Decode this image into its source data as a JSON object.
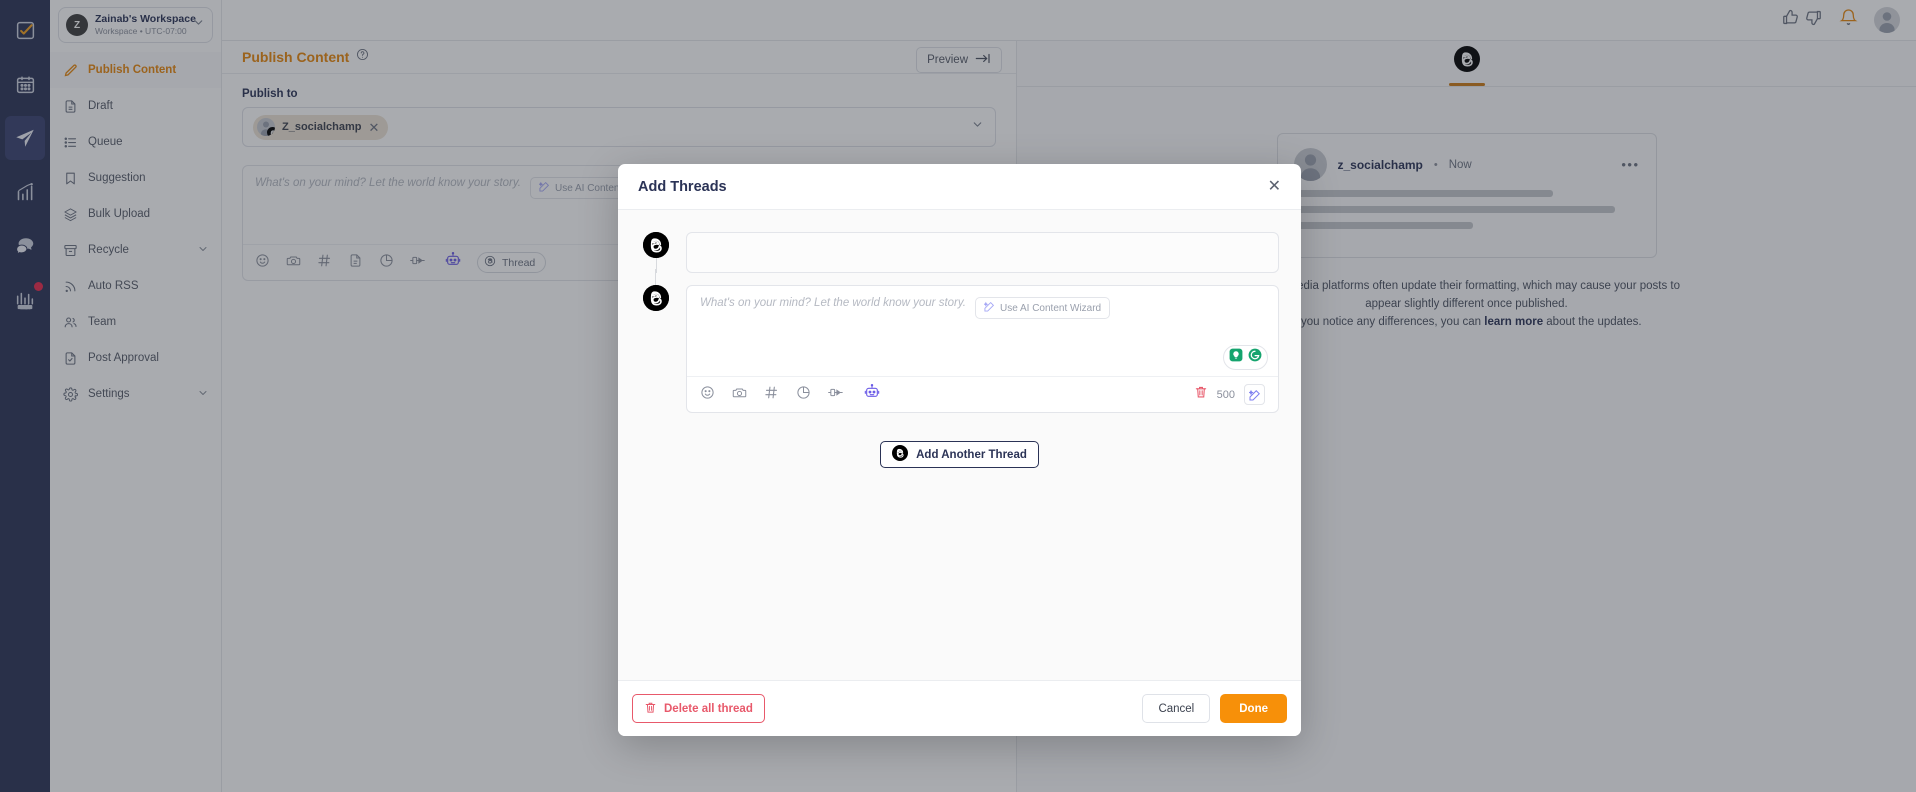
{
  "workspace": {
    "initial": "Z",
    "name": "Zainab's Workspace",
    "subtitle": "Workspace • UTC-07:00"
  },
  "rail": {
    "items": [
      {
        "icon": "checkbox-pencil-icon",
        "active": false
      },
      {
        "icon": "calendar-icon",
        "active": false
      },
      {
        "icon": "paper-plane-icon",
        "active": true
      },
      {
        "icon": "analytics-chart-icon",
        "active": false
      },
      {
        "icon": "chat-bubbles-icon",
        "active": false
      },
      {
        "icon": "beta-chart-icon",
        "active": false
      }
    ]
  },
  "sidebar": {
    "items": [
      {
        "label": "Publish Content",
        "icon": "pencil-icon",
        "active": true,
        "chevron": false
      },
      {
        "label": "Draft",
        "icon": "document-icon",
        "active": false,
        "chevron": false
      },
      {
        "label": "Queue",
        "icon": "list-icon",
        "active": false,
        "chevron": false
      },
      {
        "label": "Suggestion",
        "icon": "bookmark-icon",
        "active": false,
        "chevron": false
      },
      {
        "label": "Bulk Upload",
        "icon": "layers-icon",
        "active": false,
        "chevron": false
      },
      {
        "label": "Recycle",
        "icon": "archive-icon",
        "active": false,
        "chevron": true
      },
      {
        "label": "Auto RSS",
        "icon": "rss-icon",
        "active": false,
        "chevron": false
      },
      {
        "label": "Team",
        "icon": "people-icon",
        "active": false,
        "chevron": false
      },
      {
        "label": "Post Approval",
        "icon": "document-check-icon",
        "active": false,
        "chevron": false
      },
      {
        "label": "Settings",
        "icon": "gear-icon",
        "active": false,
        "chevron": true
      }
    ]
  },
  "page": {
    "title": "Publish Content",
    "help_icon": "question-circle-icon",
    "preview_label": "Preview",
    "preview_icon": "arrow-to-right-icon"
  },
  "composer": {
    "publish_to_label": "Publish to",
    "chip": {
      "name": "Z_socialchamp",
      "remove_icon": "close-icon",
      "badge_icon": "threads-icon"
    },
    "placeholder": "What's on your mind? Let the world know your story.",
    "wizard_label": "Use AI Content Wizard",
    "wizard_icon": "magic-wand-icon",
    "tools": [
      {
        "icon": "emoji-icon"
      },
      {
        "icon": "camera-icon"
      },
      {
        "icon": "hashtag-icon"
      },
      {
        "icon": "document-icon"
      },
      {
        "icon": "pie-chart-icon"
      },
      {
        "icon": "plug-icon"
      },
      {
        "icon": "robot-icon"
      }
    ],
    "thread_pill_label": "Thread",
    "thread_pill_icon": "threads-icon"
  },
  "preview": {
    "tab_icon": "threads-icon",
    "username": "z_socialchamp",
    "separator": "•",
    "timestamp": "Now",
    "more_icon": "ellipsis-icon",
    "skeleton_widths": [
      "75%",
      "93%",
      "52%"
    ],
    "note_line1": "Social media platforms often update their formatting, which may cause your posts",
    "note_line2": "to appear slightly different once published.",
    "note_line3_prefix": "If you notice any differences, you can ",
    "note_link": "learn more",
    "note_line3_suffix": " about the updates."
  },
  "header_icons": {
    "thumbs_up": "thumbs-up-icon",
    "thumbs_down": "thumbs-down-icon",
    "bell": "bell-icon",
    "avatar": "user-avatar-icon"
  },
  "modal": {
    "title": "Add Threads",
    "close_icon": "close-icon",
    "threads": [
      {
        "avatar_icon": "threads-icon",
        "placeholder": "",
        "type": "collapsed"
      },
      {
        "avatar_icon": "threads-icon",
        "placeholder": "What's on your mind? Let the world know your story.",
        "type": "editor",
        "wizard_label": "Use AI Content Wizard",
        "wizard_icon": "magic-wand-icon",
        "char_count": "500",
        "delete_icon": "trash-icon",
        "wand_icon": "magic-wand-icon",
        "grammarly_icons": [
          "lightbulb-icon",
          "grammarly-logo-icon"
        ],
        "tools": [
          {
            "icon": "emoji-icon"
          },
          {
            "icon": "camera-icon"
          },
          {
            "icon": "hashtag-icon"
          },
          {
            "icon": "pie-chart-icon"
          },
          {
            "icon": "plug-icon"
          },
          {
            "icon": "robot-icon"
          }
        ]
      }
    ],
    "add_another_label": "Add Another Thread",
    "add_another_icon": "threads-icon",
    "delete_all_label": "Delete all thread",
    "delete_all_icon": "trash-icon",
    "cancel_label": "Cancel",
    "done_label": "Done"
  },
  "colors": {
    "accent_orange": "#e8870c",
    "done_orange": "#f79009",
    "navy": "#2b3356",
    "rail_bg": "#2b3356",
    "danger_red": "#e8596b",
    "robot_purple": "#6c5ce7",
    "grammarly_green": "#15a46e",
    "tab_underline": "#cc7a15"
  }
}
